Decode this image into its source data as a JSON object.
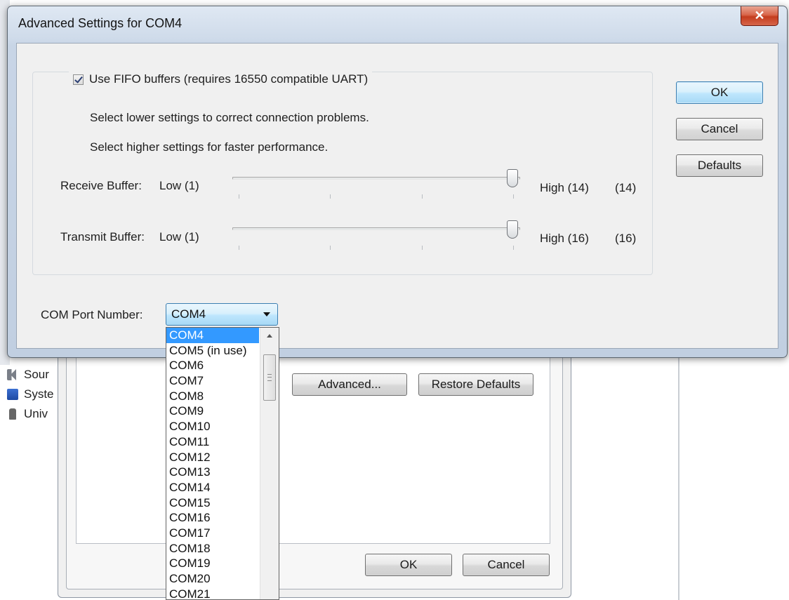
{
  "background": {
    "tree_items": [
      "Sour",
      "Syste",
      "Univ"
    ],
    "advanced_button": "Advanced...",
    "restore_defaults_button": "Restore Defaults",
    "ok_button": "OK",
    "cancel_button": "Cancel"
  },
  "dialog": {
    "title": "Advanced Settings for COM4",
    "close_glyph": "✕",
    "fifo_label": "Use FIFO buffers (requires 16550 compatible UART)",
    "fifo_checked": true,
    "hint_lower": "Select lower settings to correct connection problems.",
    "hint_higher": "Select higher settings for faster performance.",
    "receive": {
      "label": "Receive Buffer:",
      "low": "Low (1)",
      "high": "High (14)",
      "value_display": "(14)",
      "min": 1,
      "max": 14,
      "value": 14
    },
    "transmit": {
      "label": "Transmit Buffer:",
      "low": "Low (1)",
      "high": "High (16)",
      "value_display": "(16)",
      "min": 1,
      "max": 16,
      "value": 16
    },
    "buttons": {
      "ok": "OK",
      "cancel": "Cancel",
      "defaults": "Defaults"
    },
    "com_port_label": "COM Port Number:",
    "com_port_value": "COM4",
    "com_port_options": [
      "COM4",
      "COM5 (in use)",
      "COM6",
      "COM7",
      "COM8",
      "COM9",
      "COM10",
      "COM11",
      "COM12",
      "COM13",
      "COM14",
      "COM15",
      "COM16",
      "COM17",
      "COM18",
      "COM19",
      "COM20",
      "COM21"
    ],
    "selected_index": 0
  }
}
